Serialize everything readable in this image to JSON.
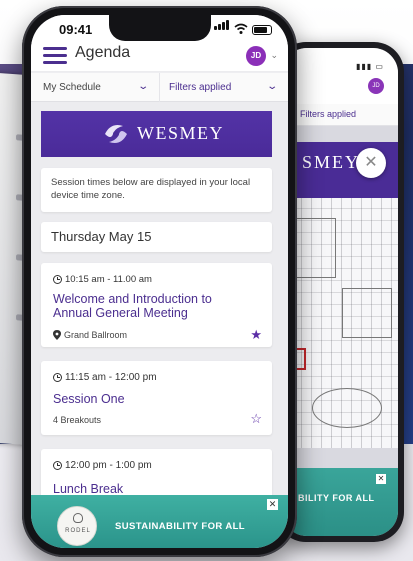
{
  "status_bar": {
    "time": "09:41"
  },
  "header": {
    "title": "Agenda",
    "user_initials": "JD"
  },
  "filters": {
    "schedule_label": "My Schedule",
    "filters_label": "Filters applied"
  },
  "brand": {
    "name": "WESMEY"
  },
  "notice": {
    "text": "Session times below are displayed in your local device time zone."
  },
  "day": {
    "label": "Thursday May 15"
  },
  "sessions": [
    {
      "time": "10:15 am - 11.00 am",
      "title": "Welcome and Introduction to Annual General Meeting",
      "location": "Grand Ballroom",
      "favorited": true
    },
    {
      "time": "11:15 am - 12:00 pm",
      "title": "Session One",
      "meta": "4 Breakouts",
      "favorited": false
    },
    {
      "time": "12:00 pm - 1:00 pm",
      "title": "Lunch Break"
    }
  ],
  "ad": {
    "logo_text": "RODEL",
    "text": "SUSTAINABILITY FOR ALL",
    "close": "✕"
  },
  "back_phone": {
    "filters_label": "Filters applied",
    "brand_partial": "SMEY",
    "close_icon": "✕",
    "ad_text": "BILITY FOR ALL",
    "avatar": "JD"
  },
  "icons": {
    "star_filled": "★",
    "star_outline": "☆",
    "chevron": "⌄"
  },
  "colors": {
    "brand_purple": "#4b2e8f",
    "avatar_purple": "#8b2fb8",
    "ad_teal": "#3aa59a"
  }
}
